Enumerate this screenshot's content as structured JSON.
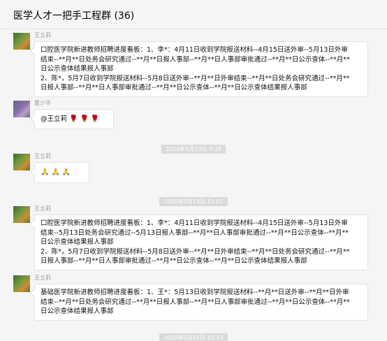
{
  "header": {
    "title": "医学人才一把手工程群 (36)"
  },
  "messages": [
    {
      "sender": "王立莉",
      "lines": [
        "口腔医学院新进教师招聘进度看板：1、李*：4月11日收到学院报送材料--4月15日送外审--5月13日外审",
        "结束--**月**日处务会研究通过--**月**日报人事部--**月**日人事部审批通过--**月**日公示查体--**月**",
        "日公示查体结果报人事部",
        "2、陈*，5月7日收到学院报送材料--5月8日送外审--**月**日外审结束--**月**日处务会研究通过--**月**",
        "日报人事部--**月**日人事部审批通过--**月**日公示查体--**月**日公示查体结果报人事部"
      ]
    },
    {
      "sender": "夏少华",
      "text": "@王立莉",
      "emojis": [
        "🌹",
        "🌹",
        "🌹"
      ]
    },
    {
      "time": "2020年5月13日 9:38"
    },
    {
      "sender": "王立莉",
      "emojis": [
        "🙏",
        "🙏",
        "🙏"
      ]
    },
    {
      "time": "2020年5月13日 15:01"
    },
    {
      "sender": "王立莉",
      "lines": [
        "口腔医学院新进教师招聘进度看板：1、李*：4月11日收到学院报送材料--4月15日送外审--5月13日外审",
        "结束--5月13日处务会研究通过--5月13日报人事部--**月**日人事部审批通过--**月**日公示查体--**月**",
        "日公示查体结果报人事部",
        "2、陈*，5月7日收到学院报送材料--5月8日送外审--**月**日外审结束--**月**日处务会研究通过--**月**",
        "日报人事部--**月**日人事部审批通过--**月**日公示查体--**月**日公示查体结果报人事部"
      ]
    },
    {
      "sender": "王立莉",
      "lines": [
        "基础医学院新进教师招聘进度看板：1、王*：5月13日收到学院报送材料--**月**日送外审--**月**日外审",
        "结束--**月**日处务会研究通过--**月**日报人事部--**月**日人事部审批通过--**月**日公示查体--**月**",
        "日公示查体结果报人事部"
      ]
    },
    {
      "time": "2020年5月15日 11:23"
    }
  ]
}
